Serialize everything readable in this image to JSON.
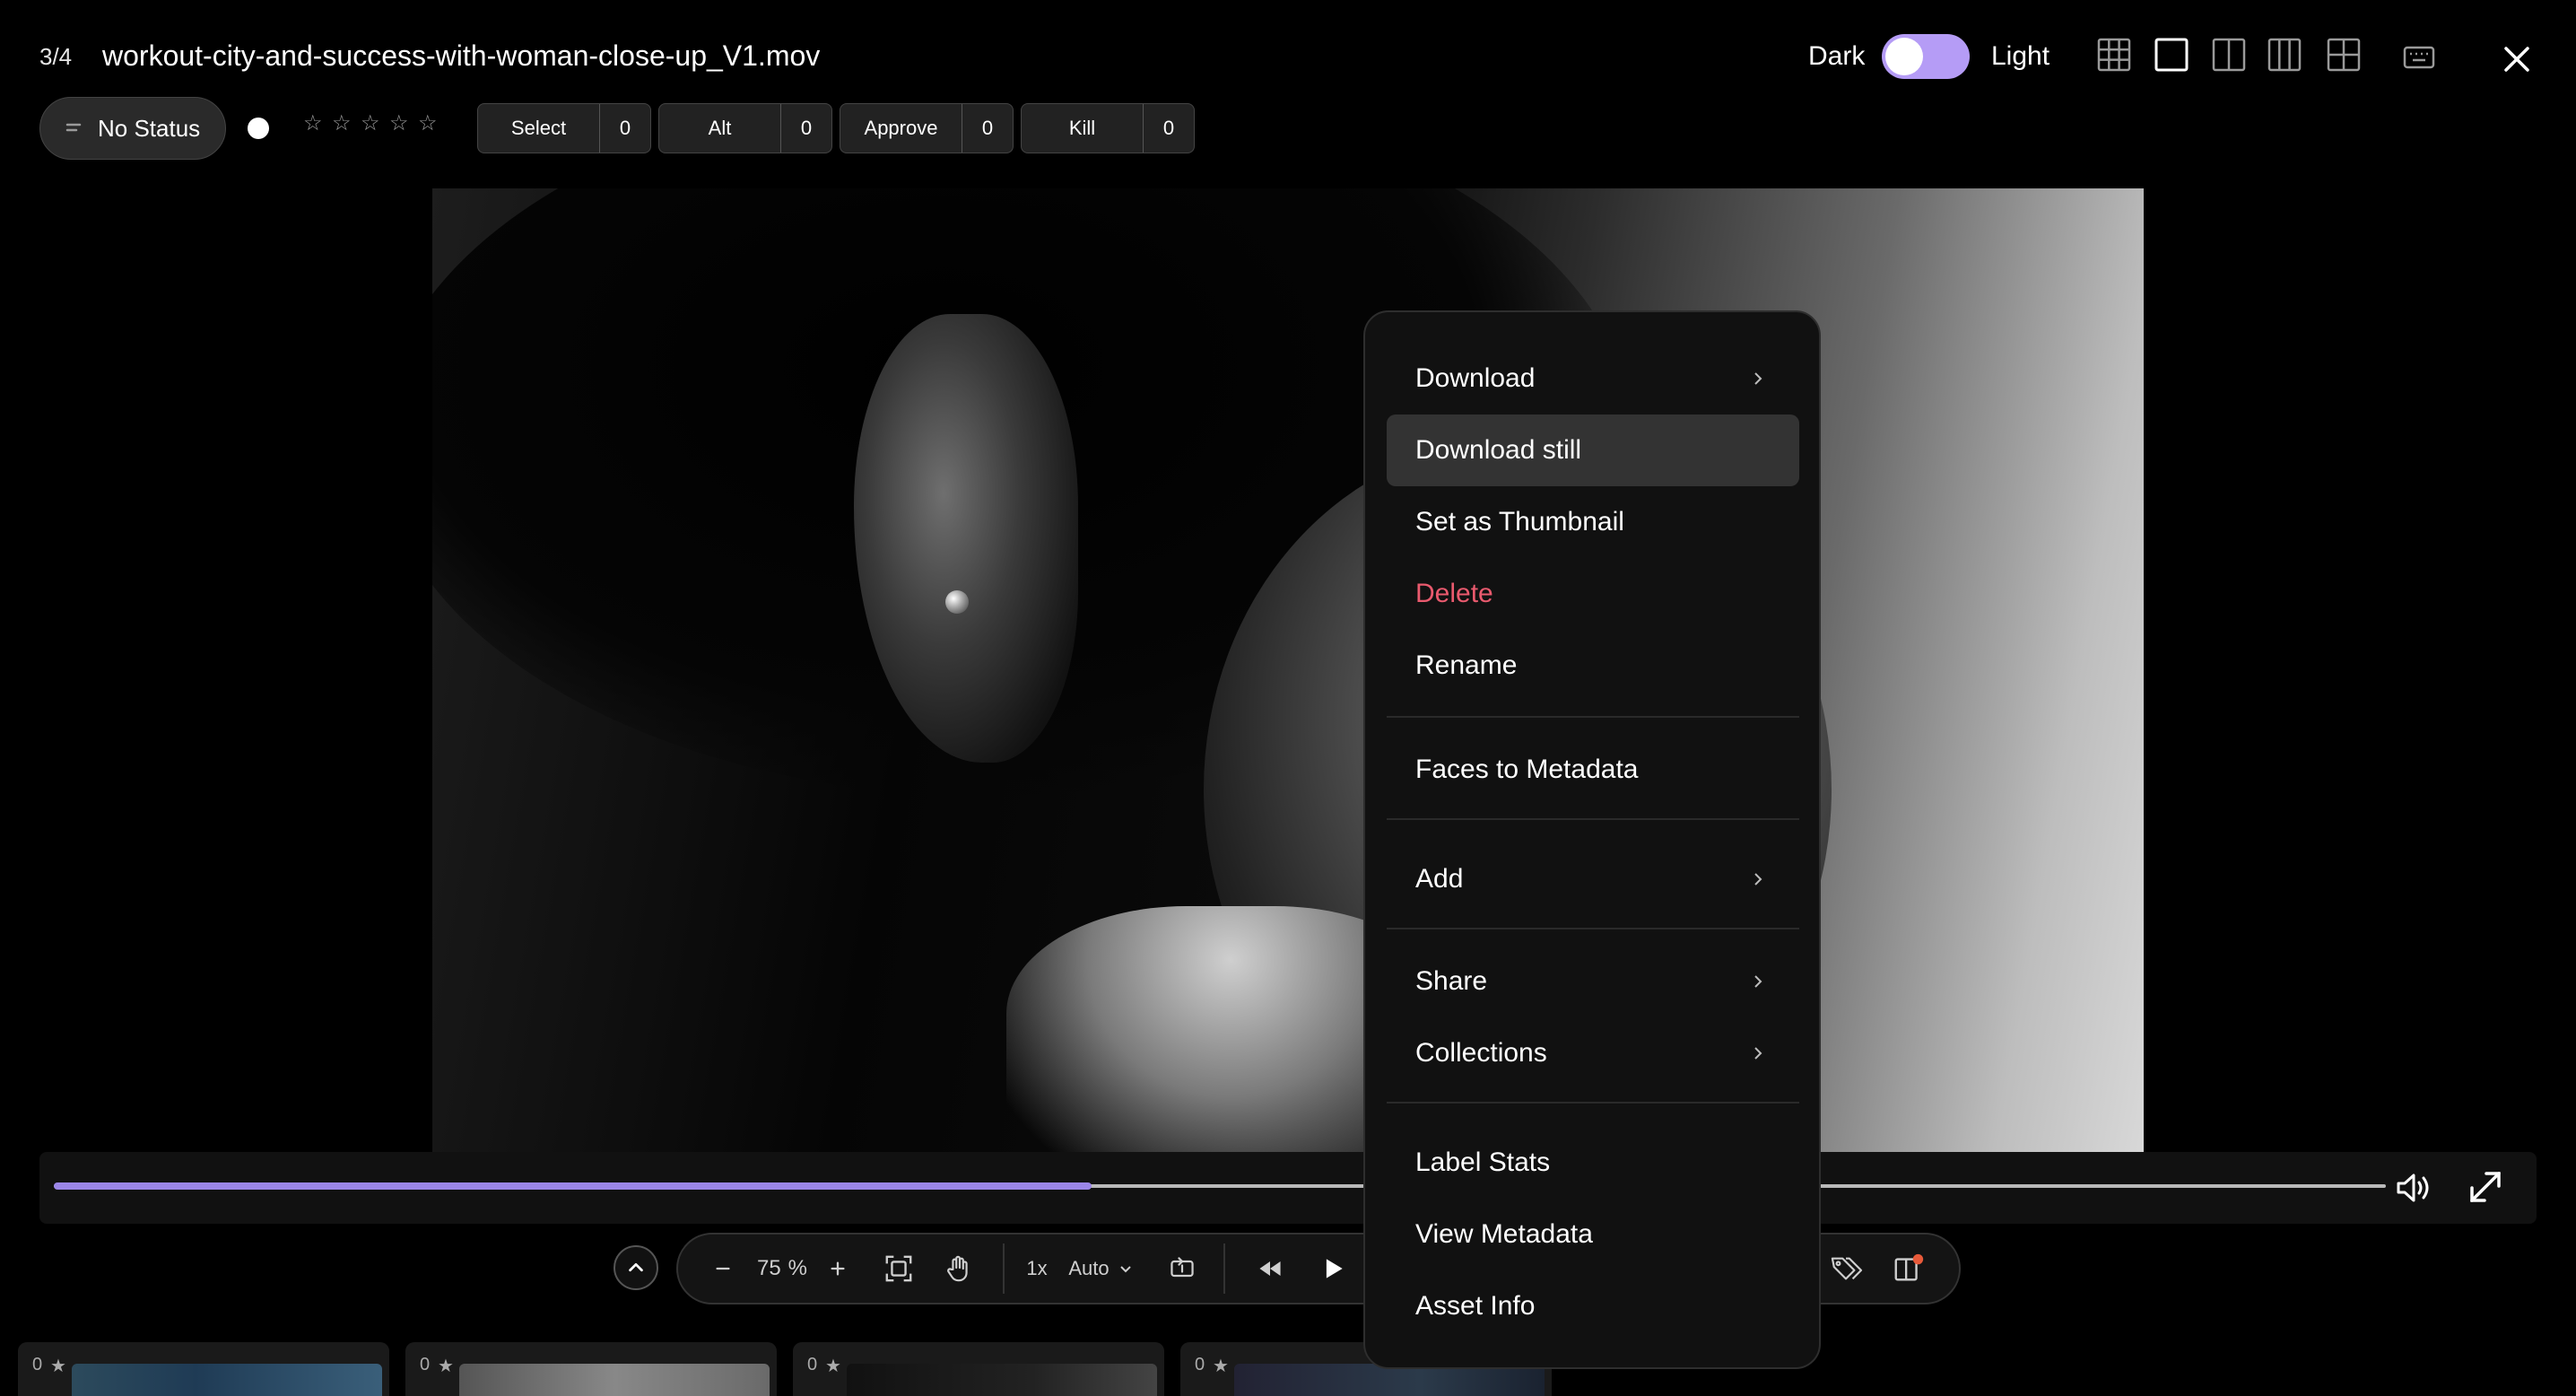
{
  "header": {
    "counter": "3/4",
    "filename": "workout-city-and-success-with-woman-close-up_V1.mov",
    "theme_dark": "Dark",
    "theme_light": "Light",
    "layout_icons": [
      "grid-layout-icon",
      "single-layout-icon",
      "split-two-layout-icon",
      "split-three-layout-icon",
      "quad-layout-icon"
    ],
    "keyboard_icon": "keyboard-icon",
    "close_icon": "close-icon"
  },
  "toolbar": {
    "status_label": "No Status",
    "rating_stars": [
      "☆",
      "☆",
      "☆",
      "☆",
      "☆"
    ],
    "labels": [
      {
        "name": "Select",
        "count": "0"
      },
      {
        "name": "Alt",
        "count": "0"
      },
      {
        "name": "Approve",
        "count": "0"
      },
      {
        "name": "Kill",
        "count": "0"
      }
    ]
  },
  "player": {
    "progress": 0.445,
    "zoom_value": "75",
    "zoom_unit": "%",
    "speed": "1x",
    "quality": "Auto"
  },
  "context_menu": {
    "items": [
      {
        "label": "Download",
        "submenu": true
      },
      {
        "label": "Download still",
        "highlighted": true
      },
      {
        "label": "Set as Thumbnail"
      },
      {
        "label": "Delete",
        "danger": true
      },
      {
        "label": "Rename"
      },
      {
        "label": "Faces to Metadata"
      },
      {
        "label": "Add",
        "submenu": true
      },
      {
        "label": "Share",
        "submenu": true
      },
      {
        "label": "Collections",
        "submenu": true
      },
      {
        "label": "Label Stats"
      },
      {
        "label": "View Metadata"
      },
      {
        "label": "Asset Info"
      }
    ]
  },
  "thumbnails": [
    {
      "rating": "0"
    },
    {
      "rating": "0"
    },
    {
      "rating": "0"
    },
    {
      "rating": "0"
    }
  ],
  "colors": {
    "accent": "#9b86e8",
    "toggle": "#b59cf6",
    "danger": "#ea5a6e"
  }
}
